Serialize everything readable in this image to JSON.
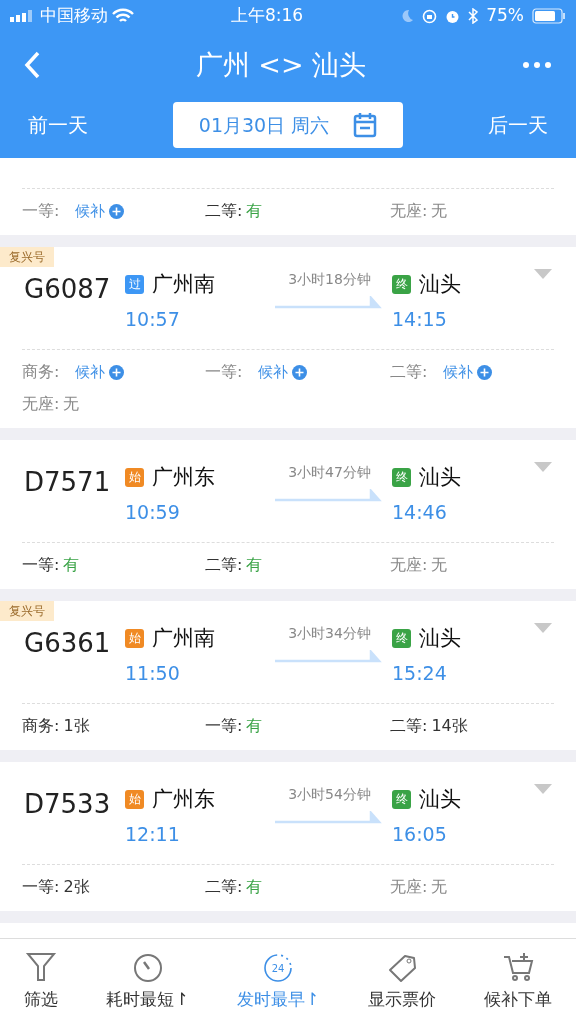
{
  "status_bar": {
    "carrier": "中国移动",
    "time": "上午8:16",
    "battery": "75%"
  },
  "nav": {
    "title": "广州 <> 汕头"
  },
  "date_bar": {
    "prev": "前一天",
    "date": "01月30日 周六",
    "next": "后一天"
  },
  "partial_seats": [
    {
      "label": "一等:",
      "value": "候补",
      "kind": "waitlist"
    },
    {
      "label": "二等:",
      "value": "有",
      "kind": "available"
    },
    {
      "label": "无座:",
      "value": "无",
      "kind": "none"
    }
  ],
  "trains": [
    {
      "badge": "复兴号",
      "number": "G6087",
      "from": {
        "tag": "过",
        "kind": "pass",
        "station": "广州南",
        "time": "10:57"
      },
      "duration": "3小时18分钟",
      "to": {
        "tag": "终",
        "kind": "end",
        "station": "汕头",
        "time": "14:15"
      },
      "seats": [
        {
          "label": "商务:",
          "value": "候补",
          "kind": "waitlist"
        },
        {
          "label": "一等:",
          "value": "候补",
          "kind": "waitlist"
        },
        {
          "label": "二等:",
          "value": "候补",
          "kind": "waitlist"
        },
        {
          "label": "无座:",
          "value": "无",
          "kind": "none"
        }
      ]
    },
    {
      "number": "D7571",
      "from": {
        "tag": "始",
        "kind": "start",
        "station": "广州东",
        "time": "10:59"
      },
      "duration": "3小时47分钟",
      "to": {
        "tag": "终",
        "kind": "end",
        "station": "汕头",
        "time": "14:46"
      },
      "seats": [
        {
          "label": "一等:",
          "value": "有",
          "kind": "available"
        },
        {
          "label": "二等:",
          "value": "有",
          "kind": "available"
        },
        {
          "label": "无座:",
          "value": "无",
          "kind": "none"
        }
      ]
    },
    {
      "badge": "复兴号",
      "number": "G6361",
      "from": {
        "tag": "始",
        "kind": "start",
        "station": "广州南",
        "time": "11:50"
      },
      "duration": "3小时34分钟",
      "to": {
        "tag": "终",
        "kind": "end",
        "station": "汕头",
        "time": "15:24"
      },
      "seats": [
        {
          "label": "商务:",
          "value": "1张",
          "kind": "count"
        },
        {
          "label": "一等:",
          "value": "有",
          "kind": "available"
        },
        {
          "label": "二等:",
          "value": "14张",
          "kind": "count"
        }
      ]
    },
    {
      "number": "D7533",
      "from": {
        "tag": "始",
        "kind": "start",
        "station": "广州东",
        "time": "12:11"
      },
      "duration": "3小时54分钟",
      "to": {
        "tag": "终",
        "kind": "end",
        "station": "汕头",
        "time": "16:05"
      },
      "seats": [
        {
          "label": "一等:",
          "value": "2张",
          "kind": "count"
        },
        {
          "label": "二等:",
          "value": "有",
          "kind": "available"
        },
        {
          "label": "无座:",
          "value": "无",
          "kind": "none"
        }
      ]
    }
  ],
  "toolbar": [
    {
      "label": "筛选",
      "kind": "filter",
      "selected": false
    },
    {
      "label": "耗时最短↾",
      "kind": "timer",
      "selected": false
    },
    {
      "label": "发时最早↾",
      "kind": "clock",
      "icon_text": "24",
      "selected": true
    },
    {
      "label": "显示票价",
      "kind": "tag",
      "selected": false
    },
    {
      "label": "候补下单",
      "kind": "cart",
      "selected": false
    }
  ]
}
